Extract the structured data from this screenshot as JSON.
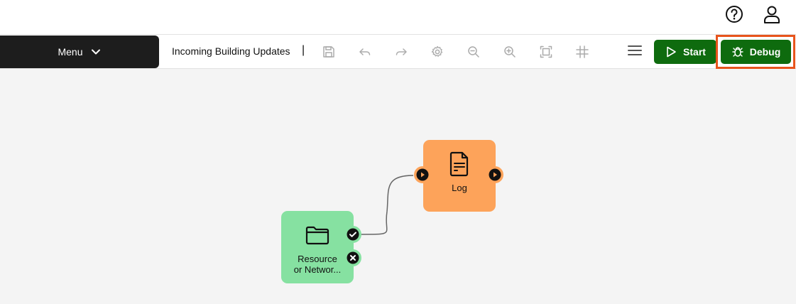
{
  "header": {
    "help_icon": "question-circle-icon",
    "user_icon": "user-profile-icon"
  },
  "toolbar": {
    "menu_label": "Menu",
    "workflow_title": "Incoming Building Updates",
    "title_separator": "|",
    "tools": [
      "save",
      "undo",
      "redo",
      "settings",
      "zoom-out",
      "zoom-in",
      "fit-to-screen",
      "grid"
    ],
    "start_label": "Start",
    "debug_label": "Debug"
  },
  "colors": {
    "primary_green": "#0e6b0e",
    "highlight_orange": "#e8541c",
    "resource_node": "#86e1a1",
    "log_node": "#fda35a",
    "menu_dark": "#1d1d1d"
  },
  "canvas": {
    "nodes": [
      {
        "id": "resource",
        "label_line1": "Resource",
        "label_line2": "or Networ...",
        "icon": "folder-icon"
      },
      {
        "id": "log",
        "label": "Log",
        "icon": "document-icon"
      }
    ]
  }
}
